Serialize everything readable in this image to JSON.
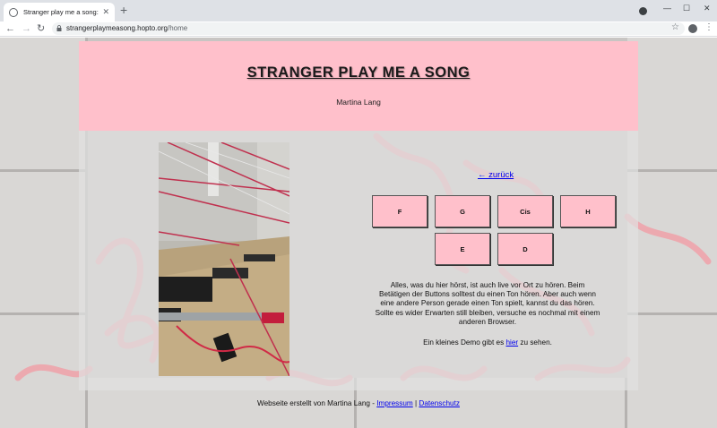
{
  "browser": {
    "tab_title": "Stranger play me a song: Home",
    "tab_close": "✕",
    "new_tab": "+",
    "url_host": "strangerplaymeasong.hopto.org",
    "url_path": "/home",
    "nav_back": "←",
    "nav_forward": "→",
    "nav_reload": "↻",
    "win_min": "—",
    "win_max": "☐",
    "win_close": "✕",
    "star": "☆",
    "menu": "⋮"
  },
  "header": {
    "title": "STRANGER PLAY ME A SONG",
    "author": "Martina Lang"
  },
  "main": {
    "back_link": "← zurück",
    "note_buttons": [
      "F",
      "G",
      "Cis",
      "H",
      "E",
      "D"
    ],
    "description": "Alles, was du hier hörst, ist auch live vor Ort zu hören. Beim Betätigen der Buttons solltest du einen Ton hören. Aber auch wenn eine andere Person gerade einen Ton spielt, kannst du das hören. Sollte es wider Erwarten still bleiben, versuche es nochmal mit einem anderen Browser.",
    "demo_prefix": "Ein kleines Demo gibt es ",
    "demo_link": "hier",
    "demo_suffix": " zu sehen."
  },
  "footer": {
    "prefix": "Webseite erstellt von Martina Lang - ",
    "impressum": "Impressum",
    "separator": " | ",
    "datenschutz": "Datenschutz"
  },
  "colors": {
    "header_bg": "#ffc0cb",
    "button_bg": "#ffc0cb",
    "link": "#0000ee"
  }
}
